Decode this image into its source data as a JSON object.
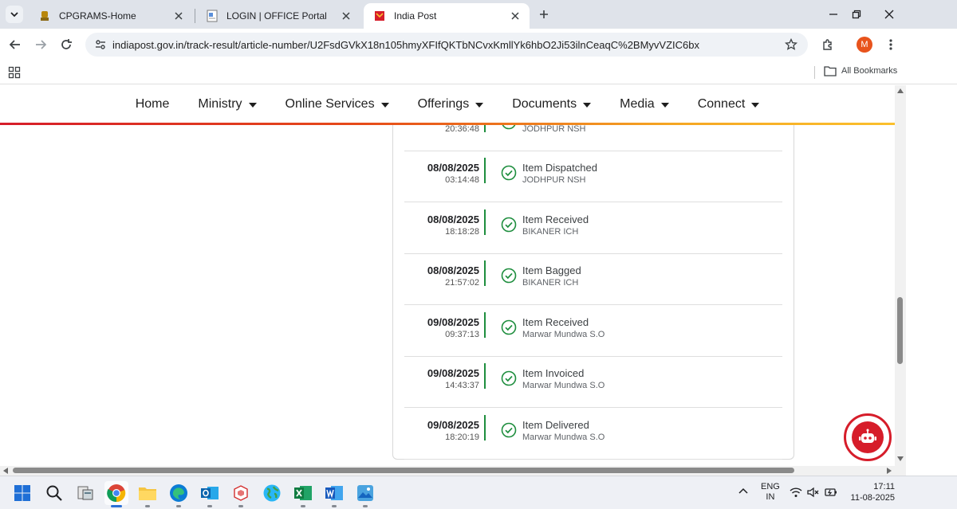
{
  "browser": {
    "tabs": [
      {
        "title": "CPGRAMS-Home",
        "active": false,
        "icon": "emblem-icon"
      },
      {
        "title": "LOGIN | OFFICE Portal",
        "active": false,
        "icon": "document-icon"
      },
      {
        "title": "India Post",
        "active": true,
        "icon": "india-post-icon"
      }
    ],
    "url": "indiapost.gov.in/track-result/article-number/U2FsdGVkX18n105hmyXFIfQKTbNCvxKmllYk6hbO2Ji53ilnCeaqC%2BMyvVZIC6bx",
    "profile_initial": "M",
    "profile_color": "#e8531c",
    "all_bookmarks_label": "All Bookmarks"
  },
  "site_nav": {
    "items": [
      {
        "label": "Home",
        "has_dropdown": false
      },
      {
        "label": "Ministry",
        "has_dropdown": true
      },
      {
        "label": "Online Services",
        "has_dropdown": true
      },
      {
        "label": "Offerings",
        "has_dropdown": true
      },
      {
        "label": "Documents",
        "has_dropdown": true
      },
      {
        "label": "Media",
        "has_dropdown": true
      },
      {
        "label": "Connect",
        "has_dropdown": true
      }
    ]
  },
  "tracking": {
    "partial_row": {
      "time": "20:36:48",
      "office": "JODHPUR NSH"
    },
    "events": [
      {
        "date": "08/08/2025",
        "time": "03:14:48",
        "status": "Item Dispatched",
        "office": "JODHPUR NSH"
      },
      {
        "date": "08/08/2025",
        "time": "18:18:28",
        "status": "Item Received",
        "office": "BIKANER ICH"
      },
      {
        "date": "08/08/2025",
        "time": "21:57:02",
        "status": "Item Bagged",
        "office": "BIKANER ICH"
      },
      {
        "date": "09/08/2025",
        "time": "09:37:13",
        "status": "Item Received",
        "office": "Marwar Mundwa S.O"
      },
      {
        "date": "09/08/2025",
        "time": "14:43:37",
        "status": "Item Invoiced",
        "office": "Marwar Mundwa S.O"
      },
      {
        "date": "09/08/2025",
        "time": "18:20:19",
        "status": "Item Delivered",
        "office": "Marwar Mundwa S.O"
      }
    ],
    "check_color": "#1e8e3e"
  },
  "taskbar": {
    "apps": [
      "start-icon",
      "search-icon",
      "file-manager-icon",
      "chrome-icon",
      "file-explorer-icon",
      "edge-icon",
      "outlook-icon",
      "store-icon",
      "globe-icon",
      "excel-icon",
      "word-icon",
      "photos-icon"
    ],
    "lang_line1": "ENG",
    "lang_line2": "IN",
    "time": "17:11",
    "date": "11-08-2025"
  },
  "colors": {
    "brand_red": "#d61d2a",
    "nav_gradient_end": "#fbc02d"
  }
}
